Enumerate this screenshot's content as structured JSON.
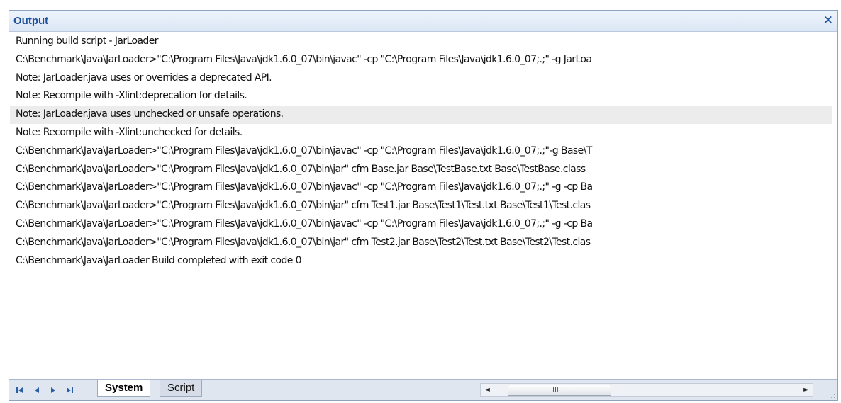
{
  "window": {
    "title": "Output",
    "close_label": "✕"
  },
  "lines": [
    "Running build script - JarLoader",
    "C:\\Benchmark\\Java\\JarLoader>\"C:\\Program Files\\Java\\jdk1.6.0_07\\bin\\javac\" -cp \"C:\\Program Files\\Java\\jdk1.6.0_07;.;\" -g JarLoa",
    "Note: JarLoader.java uses or overrides a deprecated API.",
    "Note: Recompile with -Xlint:deprecation for details.",
    "Note: JarLoader.java uses unchecked or unsafe operations.",
    "Note: Recompile with -Xlint:unchecked for details.",
    "C:\\Benchmark\\Java\\JarLoader>\"C:\\Program Files\\Java\\jdk1.6.0_07\\bin\\javac\" -cp \"C:\\Program Files\\Java\\jdk1.6.0_07;.;\"-g Base\\T",
    "C:\\Benchmark\\Java\\JarLoader>\"C:\\Program Files\\Java\\jdk1.6.0_07\\bin\\jar\" cfm Base.jar Base\\TestBase.txt Base\\TestBase.class",
    "C:\\Benchmark\\Java\\JarLoader>\"C:\\Program Files\\Java\\jdk1.6.0_07\\bin\\javac\" -cp \"C:\\Program Files\\Java\\jdk1.6.0_07;.;\" -g -cp Ba",
    "C:\\Benchmark\\Java\\JarLoader>\"C:\\Program Files\\Java\\jdk1.6.0_07\\bin\\jar\" cfm Test1.jar Base\\Test1\\Test.txt Base\\Test1\\Test.clas",
    "C:\\Benchmark\\Java\\JarLoader>\"C:\\Program Files\\Java\\jdk1.6.0_07\\bin\\javac\" -cp \"C:\\Program Files\\Java\\jdk1.6.0_07;.;\" -g -cp Ba",
    "C:\\Benchmark\\Java\\JarLoader>\"C:\\Program Files\\Java\\jdk1.6.0_07\\bin\\jar\" cfm Test2.jar Base\\Test2\\Test.txt Base\\Test2\\Test.clas",
    "C:\\Benchmark\\Java\\JarLoader Build completed with exit code 0"
  ],
  "selected_line_index": 4,
  "tabs": [
    {
      "label": "System",
      "active": true
    },
    {
      "label": "Script",
      "active": false
    }
  ],
  "nav_icons": [
    "first-icon",
    "previous-icon",
    "next-icon",
    "last-icon"
  ],
  "scrollbar": {
    "left_arrow": "◄",
    "right_arrow": "►",
    "grip": "III"
  },
  "colors": {
    "title": "#1d4f9a",
    "border": "#8ea3c0",
    "selected_row": "#ececec"
  }
}
